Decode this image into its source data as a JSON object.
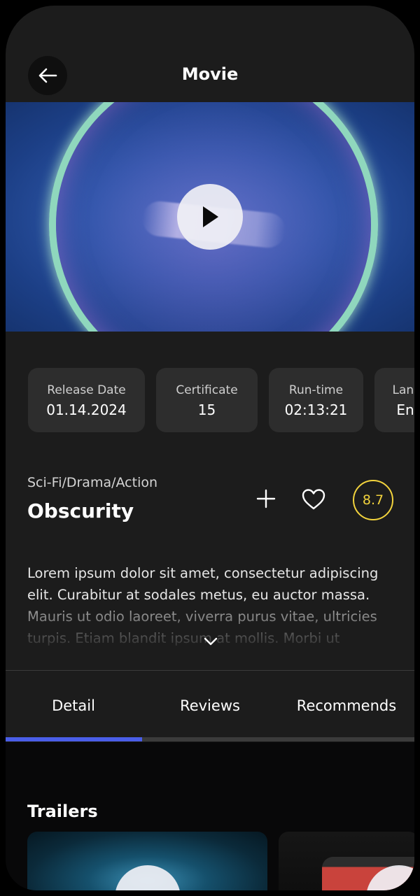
{
  "header": {
    "title": "Movie",
    "back_icon": "arrow-left-icon"
  },
  "hero": {
    "play_icon": "play-icon"
  },
  "stats": [
    {
      "label": "Release Date",
      "value": "01.14.2024"
    },
    {
      "label": "Certificate",
      "value": "15"
    },
    {
      "label": "Run-time",
      "value": "02:13:21"
    },
    {
      "label": "Language",
      "value": "English"
    }
  ],
  "movie": {
    "genres": "Sci-Fi/Drama/Action",
    "title": "Obscurity",
    "rating": "8.7",
    "description": "Lorem ipsum dolor sit amet, consectetur adipiscing elit. Curabitur at sodales metus, eu auctor massa. Mauris ut odio laoreet, viverra purus vitae, ultricies turpis. Etiam blandit ipsum at mollis. Morbi ut",
    "add_icon": "plus-icon",
    "favorite_icon": "heart-icon",
    "expand_icon": "chevron-down-icon"
  },
  "tabs": [
    {
      "label": "Detail",
      "active": true
    },
    {
      "label": "Reviews",
      "active": false
    },
    {
      "label": "Recommends",
      "active": false
    }
  ],
  "trailers": {
    "title": "Trailers"
  },
  "colors": {
    "accent": "#4a5ee8",
    "rating": "#f2d33d",
    "surface": "#1c1c1c",
    "card": "#2d2d2d"
  }
}
